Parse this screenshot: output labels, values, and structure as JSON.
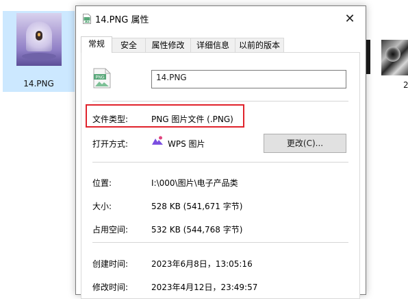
{
  "explorer": {
    "selected_file_name": "14.PNG",
    "right_file_label": "2"
  },
  "dialog": {
    "title": "14.PNG 属性",
    "close_glyph": "✕",
    "tabs": [
      "常规",
      "安全",
      "属性修改",
      "详细信息",
      "以前的版本"
    ],
    "active_tab": "常规",
    "file_name_value": "14.PNG",
    "file_icon_text": "PNG",
    "file_type": {
      "label": "文件类型:",
      "value": "PNG 图片文件 (.PNG)"
    },
    "open_with": {
      "label": "打开方式:",
      "value": "WPS 图片",
      "button": "更改(C)..."
    },
    "location": {
      "label": "位置:",
      "value": "I:\\000\\图片\\电子产品类"
    },
    "size": {
      "label": "大小:",
      "value": "528 KB (541,671 字节)"
    },
    "size_on_disk": {
      "label": "占用空间:",
      "value": "532 KB (544,768 字节)"
    },
    "created": {
      "label": "创建时间:",
      "value": "2023年6月8日，13:05:16"
    },
    "modified": {
      "label": "修改时间:",
      "value": "2023年4月12日，23:49:57"
    }
  },
  "colors": {
    "highlight_border": "#e0222b",
    "selection_bg": "#cce8ff",
    "png_icon_green": "#5aa87a",
    "wps_icon_purple": "#7b4fe0"
  }
}
